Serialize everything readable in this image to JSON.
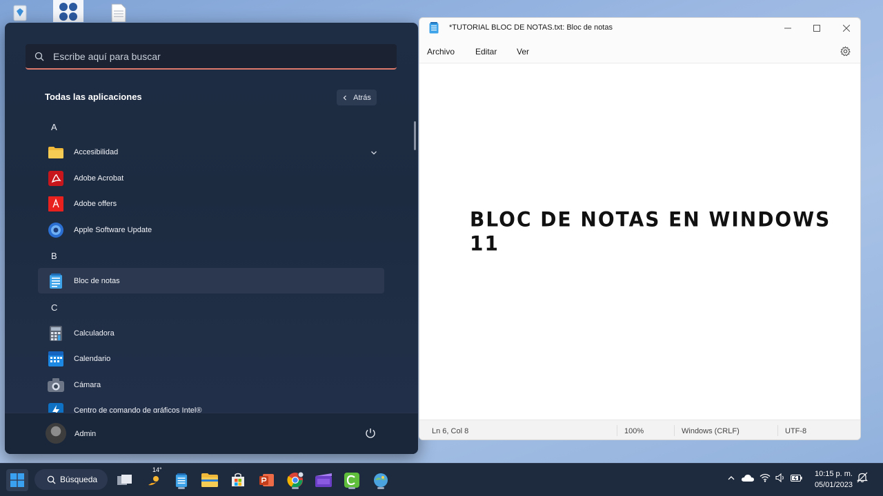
{
  "start_menu": {
    "search_placeholder": "Escribe aquí para buscar",
    "header": "Todas las aplicaciones",
    "back_label": "Atrás",
    "letters": [
      "A",
      "B",
      "C"
    ],
    "apps": [
      {
        "label": "Accesibilidad",
        "icon": "folder-icon"
      },
      {
        "label": "Adobe Acrobat",
        "icon": "acrobat-icon"
      },
      {
        "label": "Adobe offers",
        "icon": "adobe-icon"
      },
      {
        "label": "Apple Software Update",
        "icon": "apple-update-icon"
      },
      {
        "label": "Bloc de notas",
        "icon": "notepad-icon"
      },
      {
        "label": "Calculadora",
        "icon": "calculator-icon"
      },
      {
        "label": "Calendario",
        "icon": "calendar-icon"
      },
      {
        "label": "Cámara",
        "icon": "camera-icon"
      },
      {
        "label": "Centro de comando de gráficos Intel®",
        "icon": "intel-icon"
      }
    ],
    "user": "Admin"
  },
  "notepad": {
    "title": "*TUTORIAL BLOC DE NOTAS.txt: Bloc de notas",
    "menu": [
      "Archivo",
      "Editar",
      "Ver"
    ],
    "content": "BLOC DE NOTAS EN WINDOWS 11",
    "status": {
      "position": "Ln 6, Col 8",
      "zoom": "100%",
      "line_endings": "Windows (CRLF)",
      "encoding": "UTF-8"
    }
  },
  "taskbar": {
    "search_label": "Búsqueda",
    "weather_temp": "14°",
    "time": "10:15 p. m.",
    "date": "05/01/2023"
  }
}
